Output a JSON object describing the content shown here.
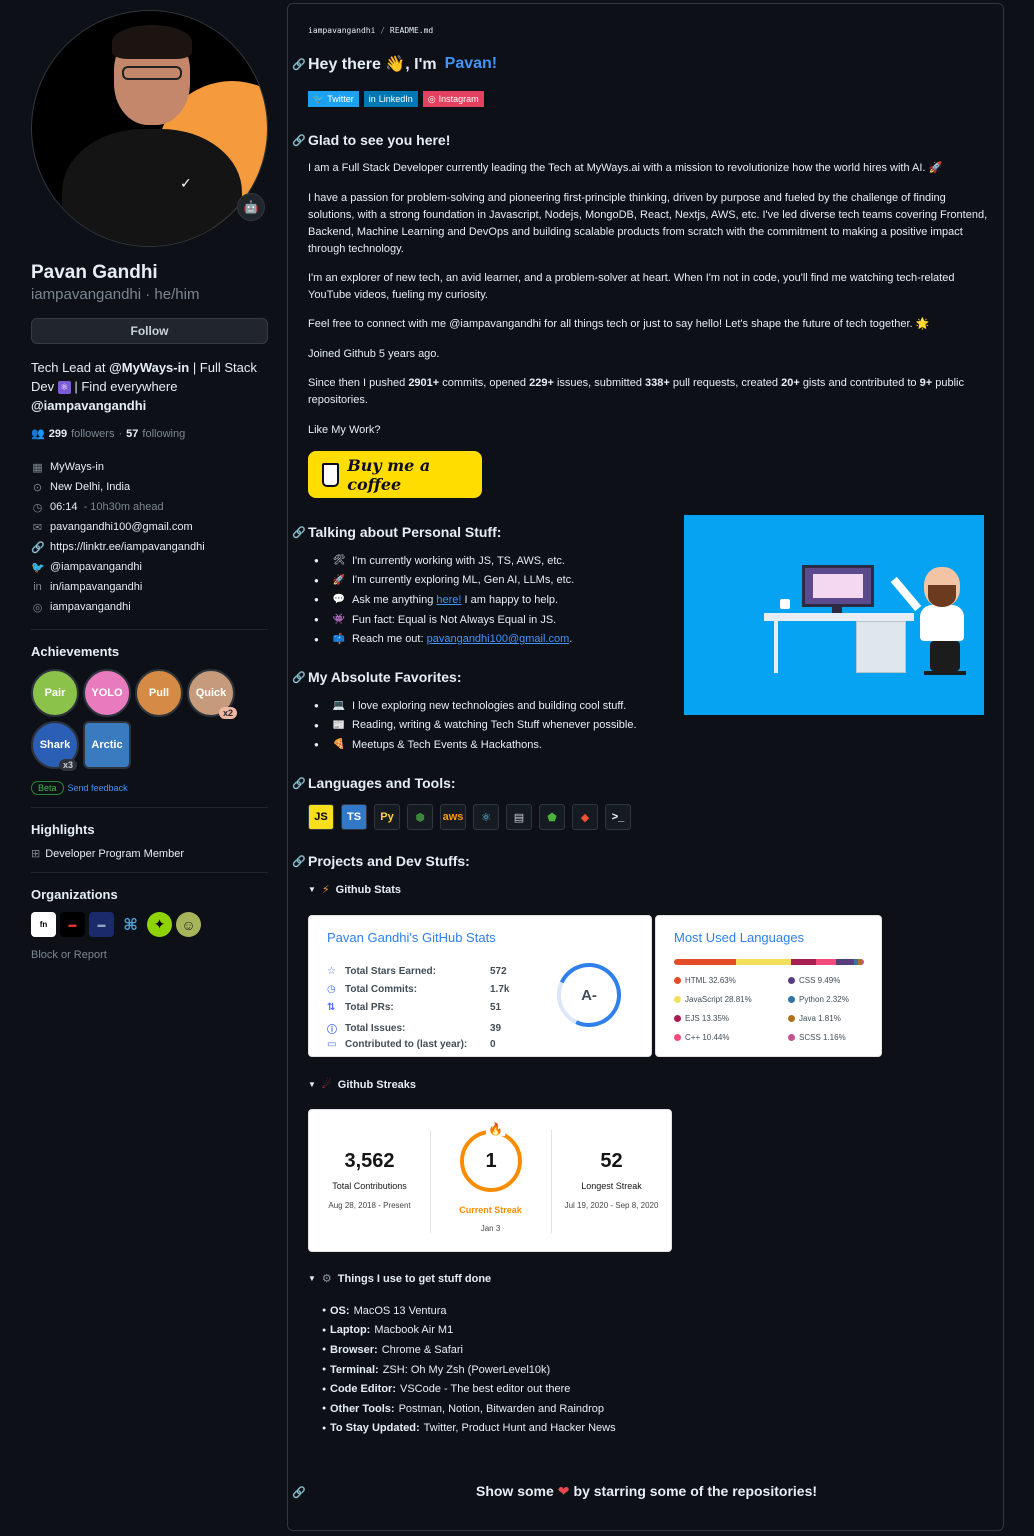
{
  "profile": {
    "name": "Pavan Gandhi",
    "login": "iampavangandhi · he/him",
    "follow_label": "Follow",
    "bio_line1": "Tech Lead at",
    "bio_org": "@MyWays-in",
    "bio_line2": "| Full Stack Dev",
    "bio_line3": "| Find everywhere",
    "bio_handle": "@iampavangandhi",
    "followers_count": "299",
    "followers_label": "followers",
    "following_count": "57",
    "following_label": "following",
    "company": "MyWays-in",
    "location": "New Delhi, India",
    "time": "06:14",
    "time_note": "- 10h30m ahead",
    "email": "pavangandhi100@gmail.com",
    "website": "https://linktr.ee/iampavangandhi",
    "twitter": "@iampavangandhi",
    "linkedin": "in/iampavangandhi",
    "instagram": "iampavangandhi"
  },
  "achievements": {
    "title": "Achievements",
    "items": [
      {
        "label": "Pair",
        "mult": ""
      },
      {
        "label": "YOLO",
        "mult": ""
      },
      {
        "label": "Pull",
        "mult": ""
      },
      {
        "label": "Quick",
        "mult": "x2"
      },
      {
        "label": "Shark",
        "mult": "x3"
      },
      {
        "label": "Arctic",
        "mult": ""
      }
    ],
    "beta_label": "Beta",
    "feedback_label": "Send feedback"
  },
  "highlights": {
    "title": "Highlights",
    "item": "Developer Program Member"
  },
  "organizations": {
    "title": "Organizations",
    "block_label": "Block or Report"
  },
  "readme": {
    "crumb_owner": "iampavangandhi",
    "crumb_file": "README.md",
    "greeting": "Hey there 👋, I'm",
    "greeting_name": "Pavan!",
    "socials": [
      {
        "label": "Twitter",
        "color": "#1da1f2"
      },
      {
        "label": "LinkedIn",
        "color": "#0077b5"
      },
      {
        "label": "Instagram",
        "color": "#e4405f"
      }
    ],
    "glad_heading": "Glad to see you here!",
    "p1": "I am a Full Stack Developer currently leading the Tech at MyWays.ai with a mission to revolutionize how the world hires with AI. 🚀",
    "p2": "I have a passion for problem-solving and pioneering first-principle thinking, driven by purpose and fueled by the challenge of finding solutions, with a strong foundation in Javascript, Nodejs, MongoDB, React, Nextjs, AWS, etc. I've led diverse tech teams covering Frontend, Backend, Machine Learning and DevOps and building scalable products from scratch with the commitment to making a positive impact through technology.",
    "p3": "I'm an explorer of new tech, an avid learner, and a problem-solver at heart. When I'm not in code, you'll find me watching tech-related YouTube videos, fueling my curiosity.",
    "p4": "Feel free to connect with me @iampavangandhi for all things tech or just to say hello! Let's shape the future of tech together. 🌟",
    "p5": "Joined Github 5 years ago.",
    "p6_a": "Since then I pushed",
    "commits": "2901+",
    "p6_b": "commits, opened",
    "issues": "229+",
    "p6_c": "issues, submitted",
    "prs": "338+",
    "p6_d": "pull requests, created",
    "gists": "20+",
    "p6_e": "gists and contributed to",
    "repos": "9+",
    "p6_f": "public repositories.",
    "like_work": "Like My Work?",
    "bmc_label": "Buy me a coffee",
    "personal_heading": "Talking about Personal Stuff:",
    "personal": [
      {
        "emoji": "🛠",
        "text": "I'm currently working with JS, TS, AWS, etc.",
        "link": "",
        "after": ""
      },
      {
        "emoji": "🚀",
        "text": "I'm currently exploring ML, Gen AI, LLMs, etc.",
        "link": "",
        "after": ""
      },
      {
        "emoji": "💬",
        "text": "Ask me anything",
        "link": "here!",
        "after": "I am happy to help."
      },
      {
        "emoji": "👾",
        "text": "Fun fact: Equal is Not Always Equal in JS.",
        "link": "",
        "after": ""
      },
      {
        "emoji": "📫",
        "text": "Reach me out:",
        "link": "pavangandhi100@gmail.com",
        "after": "."
      }
    ],
    "favorites_heading": "My Absolute Favorites:",
    "favorites": [
      {
        "emoji": "💻",
        "text": "I love exploring new technologies and building cool stuff."
      },
      {
        "emoji": "📰",
        "text": "Reading, writing & watching Tech Stuff whenever possible."
      },
      {
        "emoji": "🍕",
        "text": "Meetups & Tech Events & Hackathons."
      }
    ],
    "languages_heading": "Languages and Tools:",
    "tools": [
      {
        "name": "javascript-icon",
        "glyph": "JS",
        "bg": "#f7df1e",
        "fg": "#000"
      },
      {
        "name": "typescript-icon",
        "glyph": "TS",
        "bg": "#3178c6",
        "fg": "#fff"
      },
      {
        "name": "python-icon",
        "glyph": "Py",
        "bg": "#161b22",
        "fg": "#ffd43b"
      },
      {
        "name": "nodejs-icon",
        "glyph": "⬢",
        "bg": "#161b22",
        "fg": "#3c873a"
      },
      {
        "name": "aws-icon",
        "glyph": "aws",
        "bg": "#161b22",
        "fg": "#ff9900"
      },
      {
        "name": "react-icon",
        "glyph": "⚛",
        "bg": "#161b22",
        "fg": "#61dafb"
      },
      {
        "name": "database-icon",
        "glyph": "▤",
        "bg": "#161b22",
        "fg": "#c9d1d9"
      },
      {
        "name": "mongodb-icon",
        "glyph": "⬟",
        "bg": "#161b22",
        "fg": "#4db33d"
      },
      {
        "name": "git-icon",
        "glyph": "◆",
        "bg": "#161b22",
        "fg": "#f05033"
      },
      {
        "name": "terminal-icon",
        "glyph": ">_",
        "bg": "#161b22",
        "fg": "#fff"
      }
    ],
    "projects_heading": "Projects and Dev Stuffs:",
    "stats_summary": "Github Stats",
    "streaks_summary": "Github Streaks",
    "things_summary": "Things I use to get stuff done",
    "things": [
      {
        "label": "OS:",
        "value": "MacOS 13 Ventura"
      },
      {
        "label": "Laptop:",
        "value": "Macbook Air M1"
      },
      {
        "label": "Browser:",
        "value": "Chrome & Safari"
      },
      {
        "label": "Terminal:",
        "value": "ZSH: Oh My Zsh (PowerLevel10k)"
      },
      {
        "label": "Code Editor:",
        "value": "VSCode - The best editor out there"
      },
      {
        "label": "Other Tools:",
        "value": "Postman, Notion, Bitwarden and Raindrop"
      },
      {
        "label": "To Stay Updated:",
        "value": "Twitter, Product Hunt and Hacker News"
      }
    ],
    "footer_a": "Show some",
    "footer_b": "by starring some of the repositories!"
  },
  "github_stats": {
    "title": "Pavan Gandhi's GitHub Stats",
    "rank": "A-",
    "rows": [
      {
        "icon": "☆",
        "label": "Total Stars Earned:",
        "value": "572"
      },
      {
        "icon": "◷",
        "label": "Total Commits:",
        "value": "1.7k"
      },
      {
        "icon": "⇅",
        "label": "Total PRs:",
        "value": "51"
      },
      {
        "icon": "ⓘ",
        "label": "Total Issues:",
        "value": "39"
      },
      {
        "icon": "▭",
        "label": "Contributed to (last year):",
        "value": "0"
      }
    ]
  },
  "top_langs": {
    "title": "Most Used Languages",
    "langs": [
      {
        "name": "HTML 32.63%",
        "color": "#e34c26",
        "pct": 32.63
      },
      {
        "name": "JavaScript 28.81%",
        "color": "#f1e05a",
        "pct": 28.81
      },
      {
        "name": "EJS 13.35%",
        "color": "#a91e50",
        "pct": 13.35
      },
      {
        "name": "C++ 10.44%",
        "color": "#f34b7d",
        "pct": 10.44
      },
      {
        "name": "CSS 9.49%",
        "color": "#563d7c",
        "pct": 9.49
      },
      {
        "name": "Python 2.32%",
        "color": "#3572a5",
        "pct": 2.32
      },
      {
        "name": "Java 1.81%",
        "color": "#b07219",
        "pct": 1.81
      },
      {
        "name": "SCSS 1.16%",
        "color": "#c6538c",
        "pct": 1.16
      }
    ]
  },
  "streak": {
    "total": "3,562",
    "total_label": "Total Contributions",
    "total_range": "Aug 28, 2018 - Present",
    "current": "1",
    "current_label": "Current Streak",
    "current_range": "Jan 3",
    "longest": "52",
    "longest_label": "Longest Streak",
    "longest_range": "Jul 19, 2020 - Sep 8, 2020"
  }
}
